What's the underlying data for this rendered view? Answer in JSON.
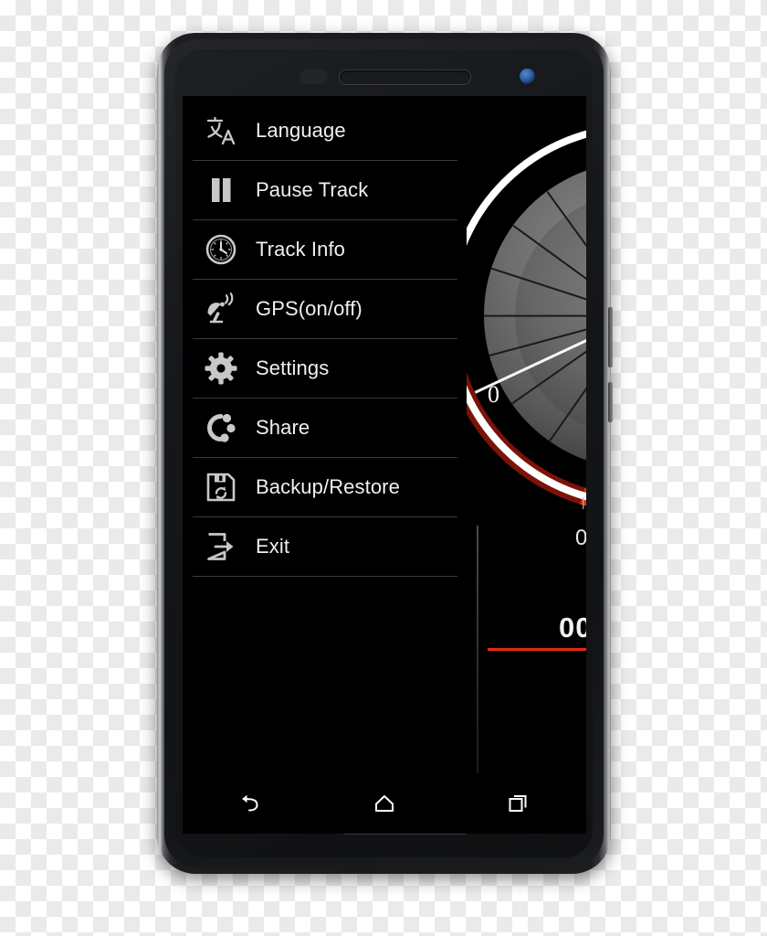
{
  "device": {
    "name": "android-smartphone",
    "hardware": {
      "sensor": "proximity-sensor",
      "earpiece": "earpiece-speaker",
      "front_camera": "front-camera-lens",
      "bottom_speaker": "bottom-speaker-grille",
      "power_button": "power-button",
      "volume_button": "volume-button"
    }
  },
  "menu": {
    "items": [
      {
        "label": "Language",
        "icon": "translate-icon"
      },
      {
        "label": "Pause Track",
        "icon": "pause-icon"
      },
      {
        "label": "Track Info",
        "icon": "clock-icon"
      },
      {
        "label": "GPS(on/off)",
        "icon": "satellite-dish-icon"
      },
      {
        "label": "Settings",
        "icon": "gear-icon"
      },
      {
        "label": "Share",
        "icon": "share-nodes-icon"
      },
      {
        "label": "Backup/Restore",
        "icon": "floppy-disk-refresh-icon"
      },
      {
        "label": "Exit",
        "icon": "exit-arrow-icon"
      }
    ]
  },
  "speedometer": {
    "needle_value": "0",
    "odometer": "00",
    "odometer_secondary": "0",
    "odometer_tiny": "|",
    "colors": {
      "outer_ring": "#ffffff",
      "warning_arc": "#c8341a",
      "warning_arc_bright": "#ff3a10",
      "dial_face": "#6e6e6e",
      "underline": "#e8280c"
    }
  },
  "navbar": {
    "buttons": [
      {
        "name": "back-button",
        "icon": "back-arrow-icon"
      },
      {
        "name": "home-button",
        "icon": "home-icon"
      },
      {
        "name": "recents-button",
        "icon": "recents-icon"
      }
    ]
  }
}
